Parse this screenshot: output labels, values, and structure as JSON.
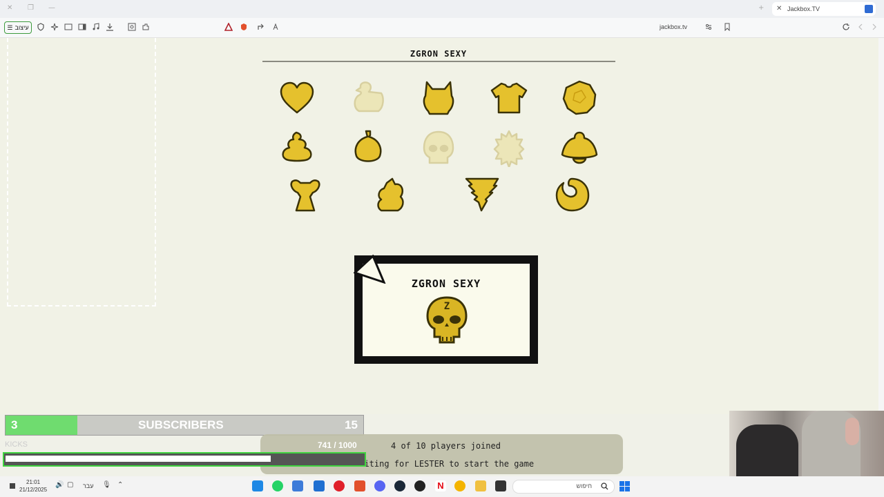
{
  "browser": {
    "tab_title": "Jackbox.TV",
    "menu_label": "עיצוב",
    "url": "jackbox.tv"
  },
  "game": {
    "room_title": "ZGRON SEXY",
    "avatars": [
      {
        "name": "heart",
        "available": true
      },
      {
        "name": "duck",
        "available": false
      },
      {
        "name": "cat",
        "available": true
      },
      {
        "name": "shirt",
        "available": true
      },
      {
        "name": "ball",
        "available": true
      },
      {
        "name": "poop",
        "available": true
      },
      {
        "name": "bomb",
        "available": true
      },
      {
        "name": "skull",
        "available": false
      },
      {
        "name": "burst",
        "available": false
      },
      {
        "name": "bell",
        "available": true
      },
      {
        "name": "trophy",
        "available": true
      },
      {
        "name": "squirrel",
        "available": true
      },
      {
        "name": "tornado",
        "available": true
      },
      {
        "name": "moon",
        "available": true
      }
    ],
    "player_card": {
      "name": "ZGRON SEXY",
      "icon_letter": "Z"
    },
    "status_line1": "4 of 10 players joined",
    "status_line2": "Waiting for LESTER to start the game"
  },
  "overlay": {
    "subs_current": "3",
    "subs_label": "SUBSCRIBERS",
    "subs_goal": "15",
    "subs_fraction": 0.2,
    "kicks_label": "KICKS",
    "kicks_count": "741 / 1000",
    "kicks_fraction": 0.741
  },
  "taskbar": {
    "time": "21:01",
    "date": "21/12/2025",
    "search_placeholder": "חיפוש",
    "lang": "עבר"
  },
  "colors": {
    "avatar_gold": "#e5c12d",
    "avatar_taken": "#ece6b8",
    "outline": "#3a3208",
    "overlay_green": "#6fdc6f"
  }
}
